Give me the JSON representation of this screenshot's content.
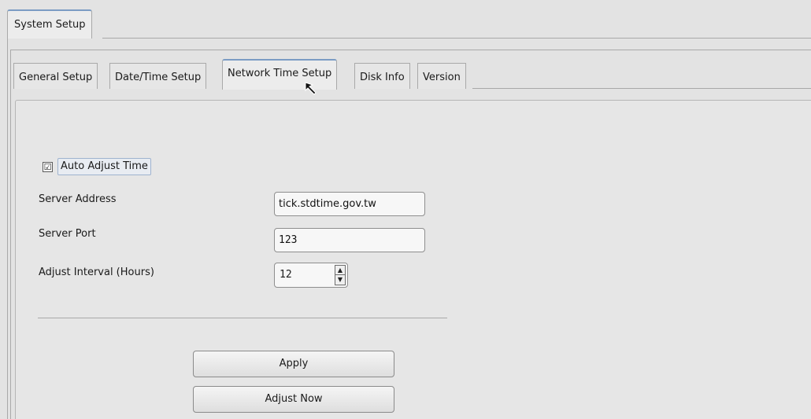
{
  "outer_tab": {
    "label": "System Setup"
  },
  "tabs": [
    {
      "label": "General Setup"
    },
    {
      "label": "Date/Time Setup"
    },
    {
      "label": "Network Time Setup"
    },
    {
      "label": "Disk Info"
    },
    {
      "label": "Version"
    }
  ],
  "active_tab": "Network Time Setup",
  "auto_adjust": {
    "label": "Auto Adjust Time",
    "checked": true,
    "check_glyph": "☑"
  },
  "server_address": {
    "label": "Server Address",
    "value": "tick.stdtime.gov.tw"
  },
  "server_port": {
    "label": "Server Port",
    "value": "123"
  },
  "adjust_interval": {
    "label": "Adjust Interval (Hours)",
    "value": "12",
    "up_glyph": "▲",
    "down_glyph": "▼"
  },
  "buttons": {
    "apply": "Apply",
    "adjust_now": "Adjust Now"
  },
  "icons": {
    "cursor": "mouse-pointer-icon"
  },
  "colors": {
    "tab_accent": "#7b9cc4",
    "background": "#e3e3e3"
  }
}
